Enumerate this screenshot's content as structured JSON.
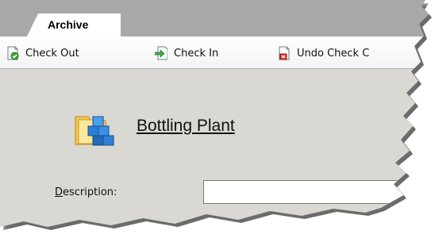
{
  "tab": {
    "label": "Archive"
  },
  "toolbar": {
    "items": [
      {
        "label": "Check Out",
        "icon": "check-out-icon"
      },
      {
        "label": "Check In",
        "icon": "check-in-icon"
      },
      {
        "label": "Undo Check C",
        "icon": "undo-check-out-icon"
      }
    ]
  },
  "item": {
    "title": "Bottling Plant",
    "icon": "folder-with-blocks-icon"
  },
  "form": {
    "description_label_first": "D",
    "description_label_rest": "escription:",
    "description_value": ""
  },
  "colors": {
    "panel_bg": "#d9d8d2",
    "tabstrip_bg": "#a8a8a8",
    "toolbar_bg": "#ffffff"
  }
}
